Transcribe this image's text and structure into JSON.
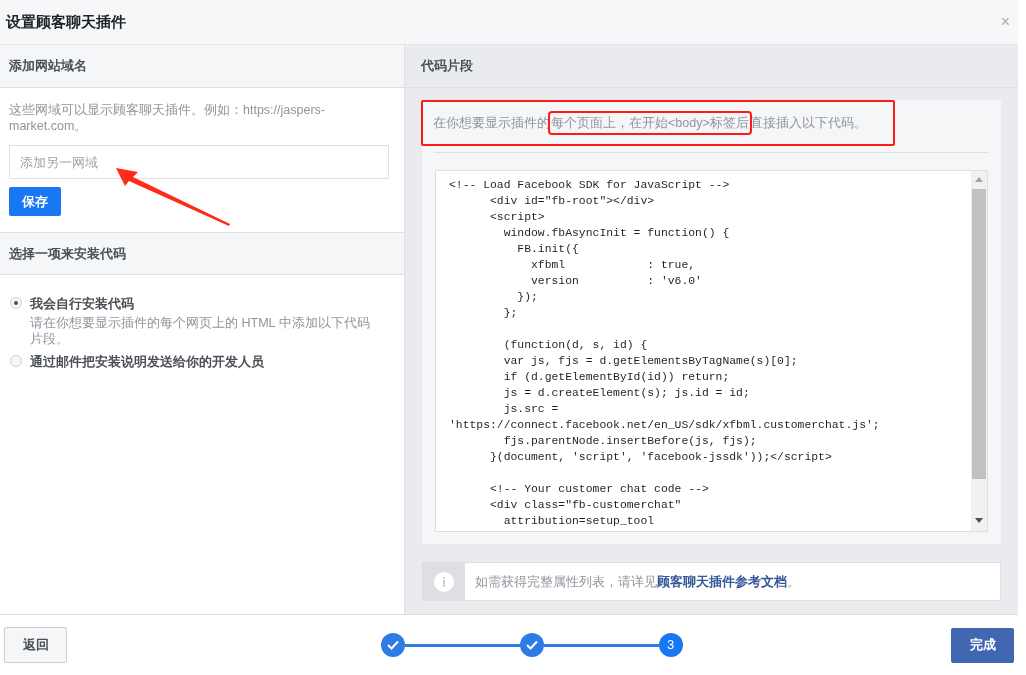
{
  "dialog": {
    "title": "设置顾客聊天插件",
    "close": "×"
  },
  "domain_section": {
    "heading": "添加网站域名",
    "description": "这些网域可以显示顾客聊天插件。例如：https://jaspers-market.com。",
    "input": {
      "placeholder": "添加另一网域"
    },
    "save_button": "保存"
  },
  "install_section": {
    "heading": "选择一项来安装代码",
    "options": [
      {
        "label": "我会自行安装代码",
        "description": "请在你想要显示插件的每个网页上的 HTML 中添加以下代码片段。",
        "selected": true
      },
      {
        "label": "通过邮件把安装说明发送给你的开发人员",
        "selected": false
      }
    ]
  },
  "code_section": {
    "heading": "代码片段",
    "instruction": {
      "before": "在你想要显示插件的",
      "highlighted": "每个页面上，在开始<body>标签后",
      "after": "直接插入以下代码。"
    },
    "code_blocks": [
      [
        "<!-- Load Facebook SDK for JavaScript -->",
        "      <div id=\"fb-root\"></div>",
        "      <script>",
        "        window.fbAsyncInit = function() {",
        "          FB.init({",
        "            xfbml            : true,",
        "            version          : 'v6.0'",
        "          });",
        "        };"
      ],
      [
        "        (function(d, s, id) {",
        "        var js, fjs = d.getElementsByTagName(s)[0];",
        "        if (d.getElementById(id)) return;",
        "        js = d.createElement(s); js.id = id;",
        "        js.src = ",
        "'https://connect.facebook.net/en_US/sdk/xfbml.customerchat.js';",
        "        fjs.parentNode.insertBefore(js, fjs);",
        "      }(document, 'script', 'facebook-jssdk'));</script>"
      ],
      [
        "      <!-- Your customer chat code -->",
        "      <div class=\"fb-customerchat\"",
        "        attribution=setup_tool"
      ]
    ],
    "info": {
      "text": "如需获得完整属性列表，请详见",
      "link": "顾客聊天插件参考文档",
      "after": "。"
    }
  },
  "footer": {
    "back_button": "返回",
    "steps": [
      {
        "done": true
      },
      {
        "done": true
      },
      {
        "done": false,
        "label": "3"
      }
    ],
    "finish_button": "完成"
  }
}
